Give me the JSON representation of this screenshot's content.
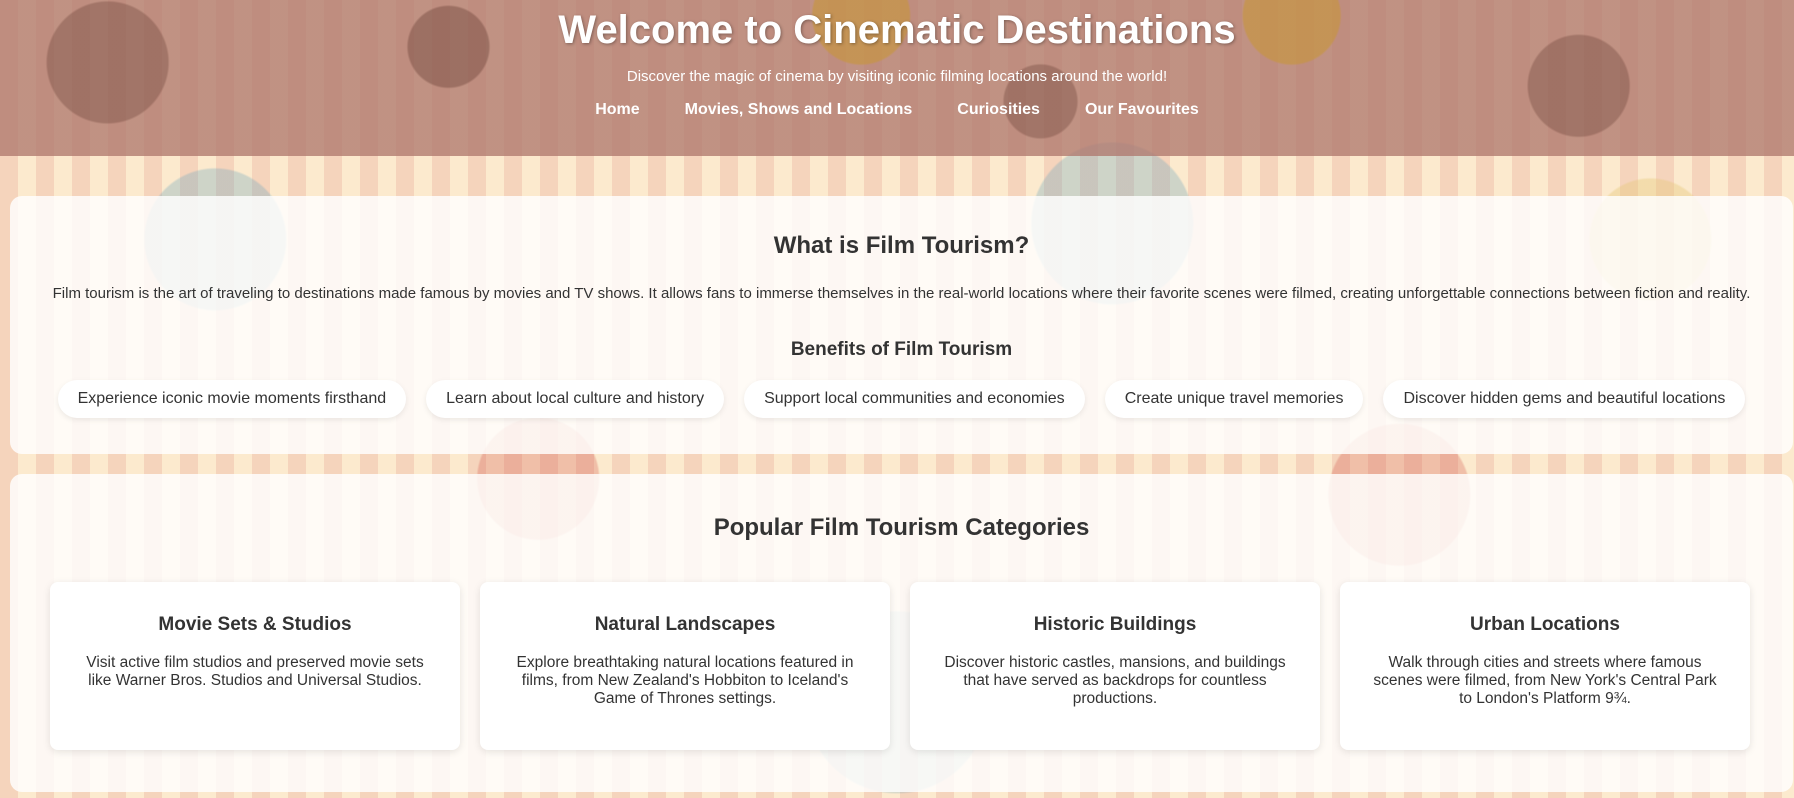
{
  "header": {
    "title": "Welcome to Cinematic Destinations",
    "tagline": "Discover the magic of cinema by visiting iconic filming locations around the world!",
    "nav": [
      {
        "label": "Home"
      },
      {
        "label": "Movies, Shows and Locations"
      },
      {
        "label": "Curiosities"
      },
      {
        "label": "Our Favourites"
      }
    ]
  },
  "intro": {
    "heading": "What is Film Tourism?",
    "text": "Film tourism is the art of traveling to destinations made famous by movies and TV shows. It allows fans to immerse themselves in the real-world locations where their favorite scenes were filmed, creating unforgettable connections between fiction and reality.",
    "benefits_heading": "Benefits of Film Tourism",
    "benefits": [
      "Experience iconic movie moments firsthand",
      "Learn about local culture and history",
      "Support local communities and economies",
      "Create unique travel memories",
      "Discover hidden gems and beautiful locations"
    ]
  },
  "categories": {
    "heading": "Popular Film Tourism Categories",
    "cards": [
      {
        "title": "Movie Sets & Studios",
        "text": "Visit active film studios and preserved movie sets like Warner Bros. Studios and Universal Studios."
      },
      {
        "title": "Natural Landscapes",
        "text": "Explore breathtaking natural locations featured in films, from New Zealand's Hobbiton to Iceland's Game of Thrones settings."
      },
      {
        "title": "Historic Buildings",
        "text": "Discover historic castles, mansions, and buildings that have served as backdrops for countless productions."
      },
      {
        "title": "Urban Locations",
        "text": "Walk through cities and streets where famous scenes were filmed, from New York's Central Park to London's Platform 9¾."
      }
    ]
  }
}
